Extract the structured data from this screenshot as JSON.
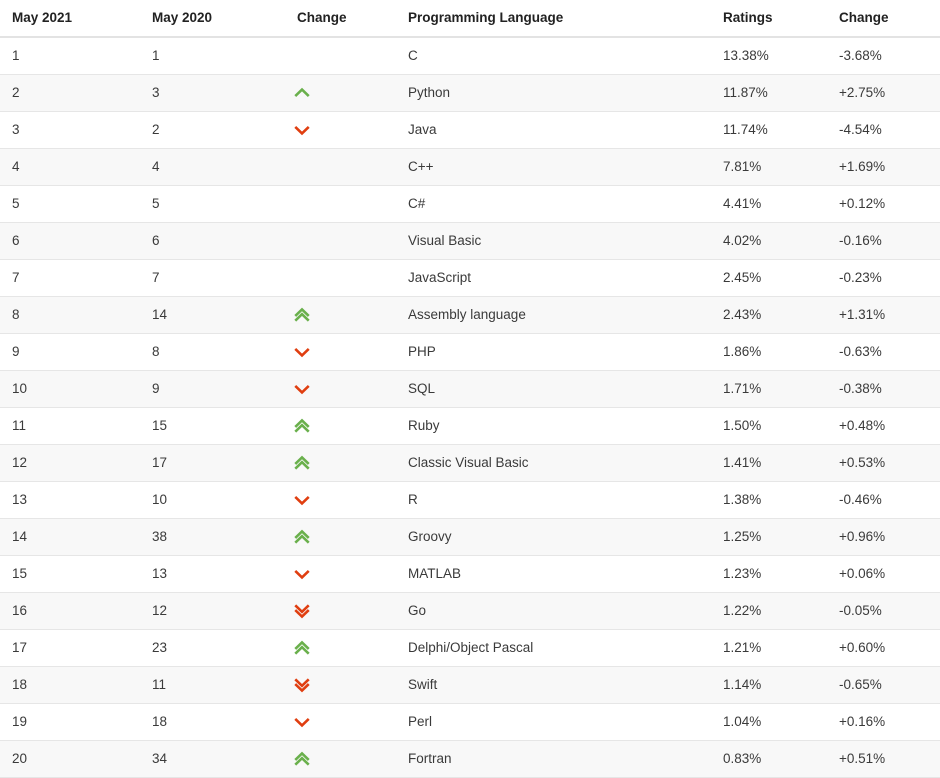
{
  "table": {
    "headers": {
      "rank_new": "May 2021",
      "rank_old": "May 2020",
      "change_icon": "Change",
      "language": "Programming Language",
      "ratings": "Ratings",
      "change_pct": "Change"
    },
    "colors": {
      "up_arrow": "#6ab04c",
      "down_arrow": "#e03e10",
      "row_stripe": "#f8f8f8",
      "row_border": "#e6e6e6",
      "header_border": "#e3e3e3",
      "text": "#3a3a3a",
      "header_text": "#222222"
    },
    "rows": [
      {
        "rank_new": "1",
        "rank_old": "1",
        "trend": "none",
        "trend_icon": "none",
        "language": "C",
        "ratings": "13.38%",
        "change_pct": "-3.68%"
      },
      {
        "rank_new": "2",
        "rank_old": "3",
        "trend": "up",
        "trend_icon": "chevron-up-icon",
        "language": "Python",
        "ratings": "11.87%",
        "change_pct": "+2.75%"
      },
      {
        "rank_new": "3",
        "rank_old": "2",
        "trend": "down",
        "trend_icon": "chevron-down-icon",
        "language": "Java",
        "ratings": "11.74%",
        "change_pct": "-4.54%"
      },
      {
        "rank_new": "4",
        "rank_old": "4",
        "trend": "none",
        "trend_icon": "none",
        "language": "C++",
        "ratings": "7.81%",
        "change_pct": "+1.69%"
      },
      {
        "rank_new": "5",
        "rank_old": "5",
        "trend": "none",
        "trend_icon": "none",
        "language": "C#",
        "ratings": "4.41%",
        "change_pct": "+0.12%"
      },
      {
        "rank_new": "6",
        "rank_old": "6",
        "trend": "none",
        "trend_icon": "none",
        "language": "Visual Basic",
        "ratings": "4.02%",
        "change_pct": "-0.16%"
      },
      {
        "rank_new": "7",
        "rank_old": "7",
        "trend": "none",
        "trend_icon": "none",
        "language": "JavaScript",
        "ratings": "2.45%",
        "change_pct": "-0.23%"
      },
      {
        "rank_new": "8",
        "rank_old": "14",
        "trend": "double-up",
        "trend_icon": "double-chevron-up-icon",
        "language": "Assembly language",
        "ratings": "2.43%",
        "change_pct": "+1.31%"
      },
      {
        "rank_new": "9",
        "rank_old": "8",
        "trend": "down",
        "trend_icon": "chevron-down-icon",
        "language": "PHP",
        "ratings": "1.86%",
        "change_pct": "-0.63%"
      },
      {
        "rank_new": "10",
        "rank_old": "9",
        "trend": "down",
        "trend_icon": "chevron-down-icon",
        "language": "SQL",
        "ratings": "1.71%",
        "change_pct": "-0.38%"
      },
      {
        "rank_new": "11",
        "rank_old": "15",
        "trend": "double-up",
        "trend_icon": "double-chevron-up-icon",
        "language": "Ruby",
        "ratings": "1.50%",
        "change_pct": "+0.48%"
      },
      {
        "rank_new": "12",
        "rank_old": "17",
        "trend": "double-up",
        "trend_icon": "double-chevron-up-icon",
        "language": "Classic Visual Basic",
        "ratings": "1.41%",
        "change_pct": "+0.53%"
      },
      {
        "rank_new": "13",
        "rank_old": "10",
        "trend": "down",
        "trend_icon": "chevron-down-icon",
        "language": "R",
        "ratings": "1.38%",
        "change_pct": "-0.46%"
      },
      {
        "rank_new": "14",
        "rank_old": "38",
        "trend": "double-up",
        "trend_icon": "double-chevron-up-icon",
        "language": "Groovy",
        "ratings": "1.25%",
        "change_pct": "+0.96%"
      },
      {
        "rank_new": "15",
        "rank_old": "13",
        "trend": "down",
        "trend_icon": "chevron-down-icon",
        "language": "MATLAB",
        "ratings": "1.23%",
        "change_pct": "+0.06%"
      },
      {
        "rank_new": "16",
        "rank_old": "12",
        "trend": "double-down",
        "trend_icon": "double-chevron-down-icon",
        "language": "Go",
        "ratings": "1.22%",
        "change_pct": "-0.05%"
      },
      {
        "rank_new": "17",
        "rank_old": "23",
        "trend": "double-up",
        "trend_icon": "double-chevron-up-icon",
        "language": "Delphi/Object Pascal",
        "ratings": "1.21%",
        "change_pct": "+0.60%"
      },
      {
        "rank_new": "18",
        "rank_old": "11",
        "trend": "double-down",
        "trend_icon": "double-chevron-down-icon",
        "language": "Swift",
        "ratings": "1.14%",
        "change_pct": "-0.65%"
      },
      {
        "rank_new": "19",
        "rank_old": "18",
        "trend": "down",
        "trend_icon": "chevron-down-icon",
        "language": "Perl",
        "ratings": "1.04%",
        "change_pct": "+0.16%"
      },
      {
        "rank_new": "20",
        "rank_old": "34",
        "trend": "double-up",
        "trend_icon": "double-chevron-up-icon",
        "language": "Fortran",
        "ratings": "0.83%",
        "change_pct": "+0.51%"
      }
    ]
  }
}
